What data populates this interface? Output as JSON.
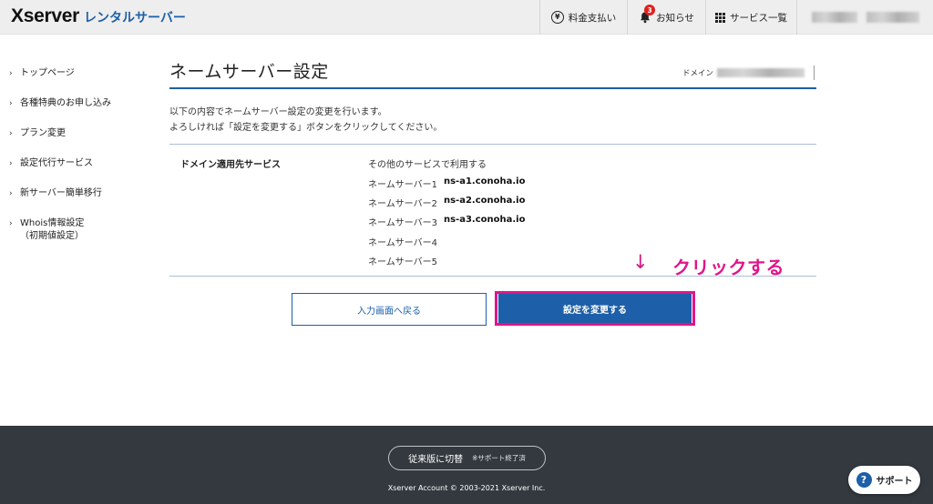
{
  "header": {
    "logo_main": "Xserver",
    "logo_sub": "レンタルサーバー",
    "fee_label": "料金支払い",
    "fee_icon": "yen-icon",
    "news_label": "お知らせ",
    "news_badge": "3",
    "services_label": "サービス一覧"
  },
  "sidebar": {
    "items": [
      {
        "label": "トップページ"
      },
      {
        "label": "各種特典のお申し込み"
      },
      {
        "label": "プラン変更"
      },
      {
        "label": "設定代行サービス"
      },
      {
        "label": "新サーバー簡単移行"
      },
      {
        "label": "Whois情報設定\n（初期値設定）"
      }
    ]
  },
  "main": {
    "title": "ネームサーバー設定",
    "domain_label": "ドメイン",
    "intro_line1": "以下の内容でネームサーバー設定の変更を行います。",
    "intro_line2": "よろしければ「設定を変更する」ボタンをクリックしてください。",
    "row_label": "ドメイン適用先サービス",
    "service": "その他のサービスで利用する",
    "nameservers": [
      {
        "label": "ネームサーバー1",
        "value": "ns-a1.conoha.io"
      },
      {
        "label": "ネームサーバー2",
        "value": "ns-a2.conoha.io"
      },
      {
        "label": "ネームサーバー3",
        "value": "ns-a3.conoha.io"
      },
      {
        "label": "ネームサーバー4",
        "value": ""
      },
      {
        "label": "ネームサーバー5",
        "value": ""
      }
    ],
    "annotation_arrow": "↓",
    "annotation_text": "クリックする",
    "back_button": "入力画面へ戻る",
    "submit_button": "設定を変更する"
  },
  "footer": {
    "legacy_button": "従来版に切替",
    "legacy_note": "※サポート終了済",
    "copyright": "Xserver Account © 2003-2021 Xserver Inc.",
    "support_button": "サポート"
  },
  "colors": {
    "brand_blue": "#1d5fa8",
    "annotation_pink": "#e0158a",
    "footer_bg": "#33393f"
  }
}
